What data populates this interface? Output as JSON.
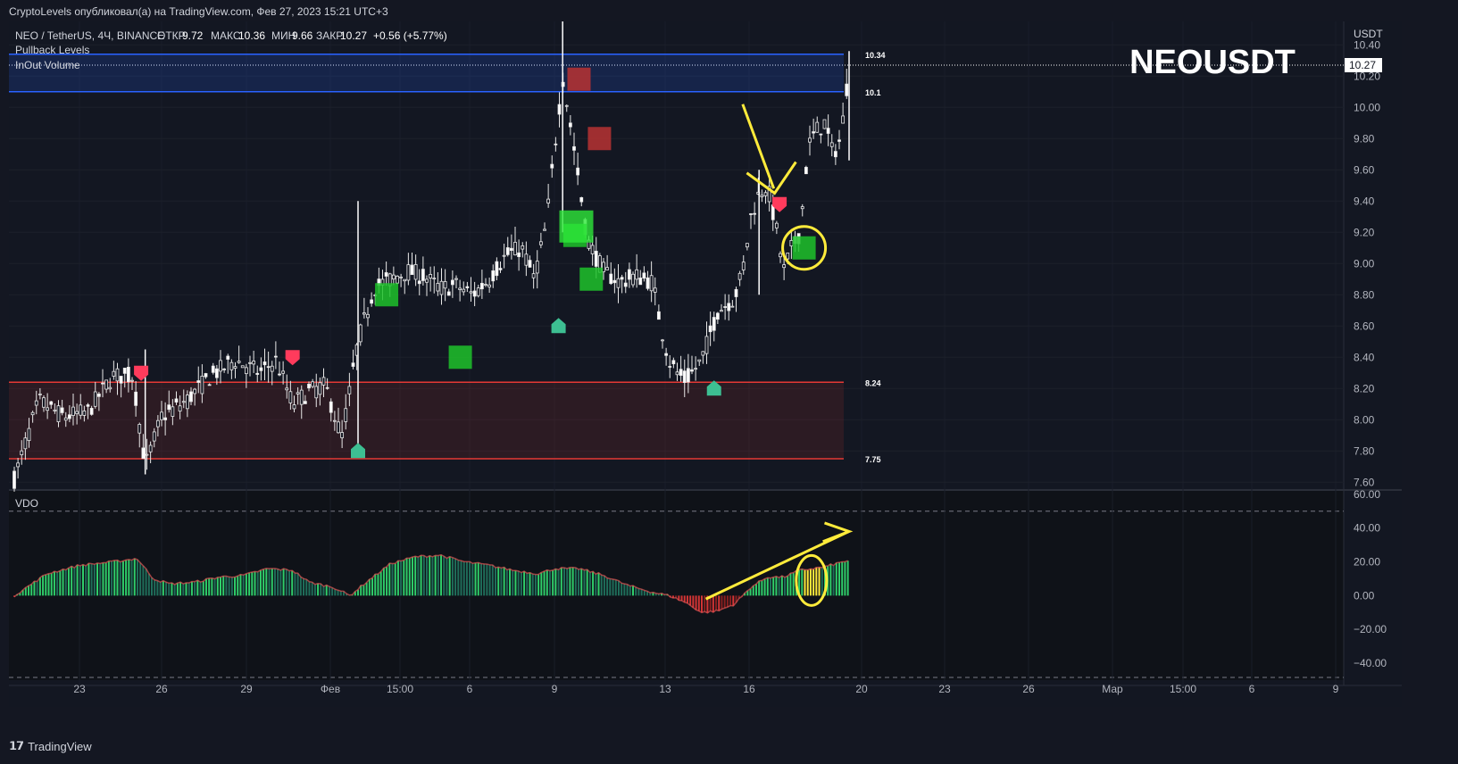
{
  "header": {
    "publisher": "CryptoLevels опубликовал(а) на TradingView.com, Фев 27, 2023 15:21 UTC+3"
  },
  "symbol": {
    "name": "NEO / TetherUS, 4Ч, BINANCE",
    "open_label": "ОТКР",
    "open": "9.72",
    "high_label": "МАКС",
    "high": "10.36",
    "low_label": "МИН",
    "low": "9.66",
    "close_label": "ЗАКР",
    "close": "10.27",
    "change": "+0.56 (+5.77%)",
    "big_label": "NEOUSDT",
    "currency": "USDT"
  },
  "indicators": [
    "Pullback Levels",
    "InOut Volume"
  ],
  "footer": {
    "brand": "TradingView"
  },
  "colors": {
    "background": "#141722",
    "candle": "#e8e8e8",
    "resistance": "#2962ff",
    "support": "#e53935",
    "green_box": "#1fc22a",
    "red_box": "#b83232",
    "vdo_green": "#26a65b",
    "vdo_red": "#c62828",
    "annotation": "#ffeb3b"
  },
  "chart_data": {
    "type": "candlestick",
    "x_ticks": [
      "23",
      "26",
      "29",
      "Фев",
      "15:00",
      "6",
      "9",
      "13",
      "16",
      "20",
      "23",
      "26",
      "Мар",
      "15:00",
      "6",
      "9"
    ],
    "ylim": [
      7.55,
      10.55
    ],
    "y_ticks": [
      "10.40",
      "10.20",
      "10.00",
      "9.80",
      "9.60",
      "9.40",
      "9.20",
      "9.00",
      "8.80",
      "8.60",
      "8.40",
      "8.20",
      "8.00",
      "7.80",
      "7.60"
    ],
    "last_price": "10.27",
    "levels": [
      {
        "value": 10.34,
        "label": "10.34",
        "kind": "resistance"
      },
      {
        "value": 10.1,
        "label": "10.1",
        "kind": "resistance"
      },
      {
        "value": 8.24,
        "label": "8.24",
        "kind": "support"
      },
      {
        "value": 7.75,
        "label": "7.75",
        "kind": "support"
      }
    ],
    "close_path": [
      [
        0,
        7.62
      ],
      [
        3,
        8.12
      ],
      [
        6,
        8.02
      ],
      [
        9,
        8.05
      ],
      [
        12,
        8.28
      ],
      [
        14.5,
        8.28
      ],
      [
        16,
        7.7
      ],
      [
        18,
        8.02
      ],
      [
        21,
        8.12
      ],
      [
        24,
        8.28
      ],
      [
        27,
        8.38
      ],
      [
        30,
        8.3
      ],
      [
        32,
        8.38
      ],
      [
        34,
        8.1
      ],
      [
        36,
        8.18
      ],
      [
        38,
        8.22
      ],
      [
        40,
        7.88
      ],
      [
        42,
        8.5
      ],
      [
        44,
        8.85
      ],
      [
        46,
        8.9
      ],
      [
        48,
        8.95
      ],
      [
        50,
        8.92
      ],
      [
        52,
        8.84
      ],
      [
        54,
        8.86
      ],
      [
        56,
        8.8
      ],
      [
        58,
        8.9
      ],
      [
        60,
        9.05
      ],
      [
        62,
        9.1
      ],
      [
        63.5,
        8.9
      ],
      [
        65,
        9.25
      ],
      [
        67,
        10.2
      ],
      [
        68.5,
        9.7
      ],
      [
        70,
        9.15
      ],
      [
        72,
        8.95
      ],
      [
        74,
        8.88
      ],
      [
        76,
        8.92
      ],
      [
        78,
        8.88
      ],
      [
        79,
        8.6
      ],
      [
        80,
        8.38
      ],
      [
        81,
        8.3
      ],
      [
        82,
        8.25
      ],
      [
        84,
        8.38
      ],
      [
        85,
        8.55
      ],
      [
        86,
        8.7
      ],
      [
        88,
        8.78
      ],
      [
        89,
        8.95
      ],
      [
        90,
        9.3
      ],
      [
        91,
        9.45
      ],
      [
        92,
        9.5
      ],
      [
        93,
        9.25
      ],
      [
        94,
        8.95
      ],
      [
        95,
        9.1
      ],
      [
        96,
        9.2
      ],
      [
        97,
        9.75
      ],
      [
        98,
        9.85
      ],
      [
        99,
        9.9
      ],
      [
        100,
        9.7
      ],
      [
        101,
        9.8
      ],
      [
        102,
        10.27
      ]
    ],
    "signal_boxes": [
      {
        "x": 45.5,
        "y": 8.8,
        "color": "green"
      },
      {
        "x": 54.5,
        "y": 8.4,
        "color": "green"
      },
      {
        "x": 68.5,
        "y": 9.18,
        "color": "green"
      },
      {
        "x": 70.5,
        "y": 8.9,
        "color": "green"
      },
      {
        "x": 69,
        "y": 10.18,
        "color": "red"
      },
      {
        "x": 71.5,
        "y": 9.8,
        "color": "red"
      },
      {
        "x": 96.5,
        "y": 9.1,
        "color": "green"
      }
    ],
    "signal_markers": [
      {
        "x": 15.5,
        "y": 8.3,
        "dir": "down"
      },
      {
        "x": 34,
        "y": 8.4,
        "dir": "down"
      },
      {
        "x": 93.5,
        "y": 9.38,
        "dir": "down"
      },
      {
        "x": 42,
        "y": 7.8,
        "dir": "up"
      },
      {
        "x": 66.5,
        "y": 8.6,
        "dir": "up"
      },
      {
        "x": 85.5,
        "y": 8.2,
        "dir": "up"
      }
    ],
    "vdo": {
      "label": "VDO",
      "ylim": [
        -50,
        62
      ],
      "y_ticks": [
        "60.00",
        "40.00",
        "20.00",
        "0.00",
        "−20.00",
        "−40.00"
      ],
      "values_path": [
        [
          0,
          0
        ],
        [
          4,
          13
        ],
        [
          8,
          18
        ],
        [
          12,
          20
        ],
        [
          15,
          22
        ],
        [
          17,
          10
        ],
        [
          19,
          7
        ],
        [
          22,
          8
        ],
        [
          25,
          11
        ],
        [
          28,
          12
        ],
        [
          31,
          16
        ],
        [
          34,
          15
        ],
        [
          36,
          8
        ],
        [
          39,
          5
        ],
        [
          41,
          0
        ],
        [
          43,
          8
        ],
        [
          46,
          19
        ],
        [
          49,
          23
        ],
        [
          52,
          24
        ],
        [
          55,
          20
        ],
        [
          58,
          18
        ],
        [
          61,
          15
        ],
        [
          64,
          13
        ],
        [
          66,
          16
        ],
        [
          69,
          16
        ],
        [
          72,
          12
        ],
        [
          75,
          6
        ],
        [
          78,
          2
        ],
        [
          80,
          0
        ],
        [
          82,
          -4
        ],
        [
          84,
          -10
        ],
        [
          86,
          -9
        ],
        [
          88,
          -5
        ],
        [
          90,
          5
        ],
        [
          92,
          11
        ],
        [
          94,
          11
        ],
        [
          96,
          15
        ],
        [
          99,
          17
        ],
        [
          102,
          21
        ]
      ]
    }
  }
}
